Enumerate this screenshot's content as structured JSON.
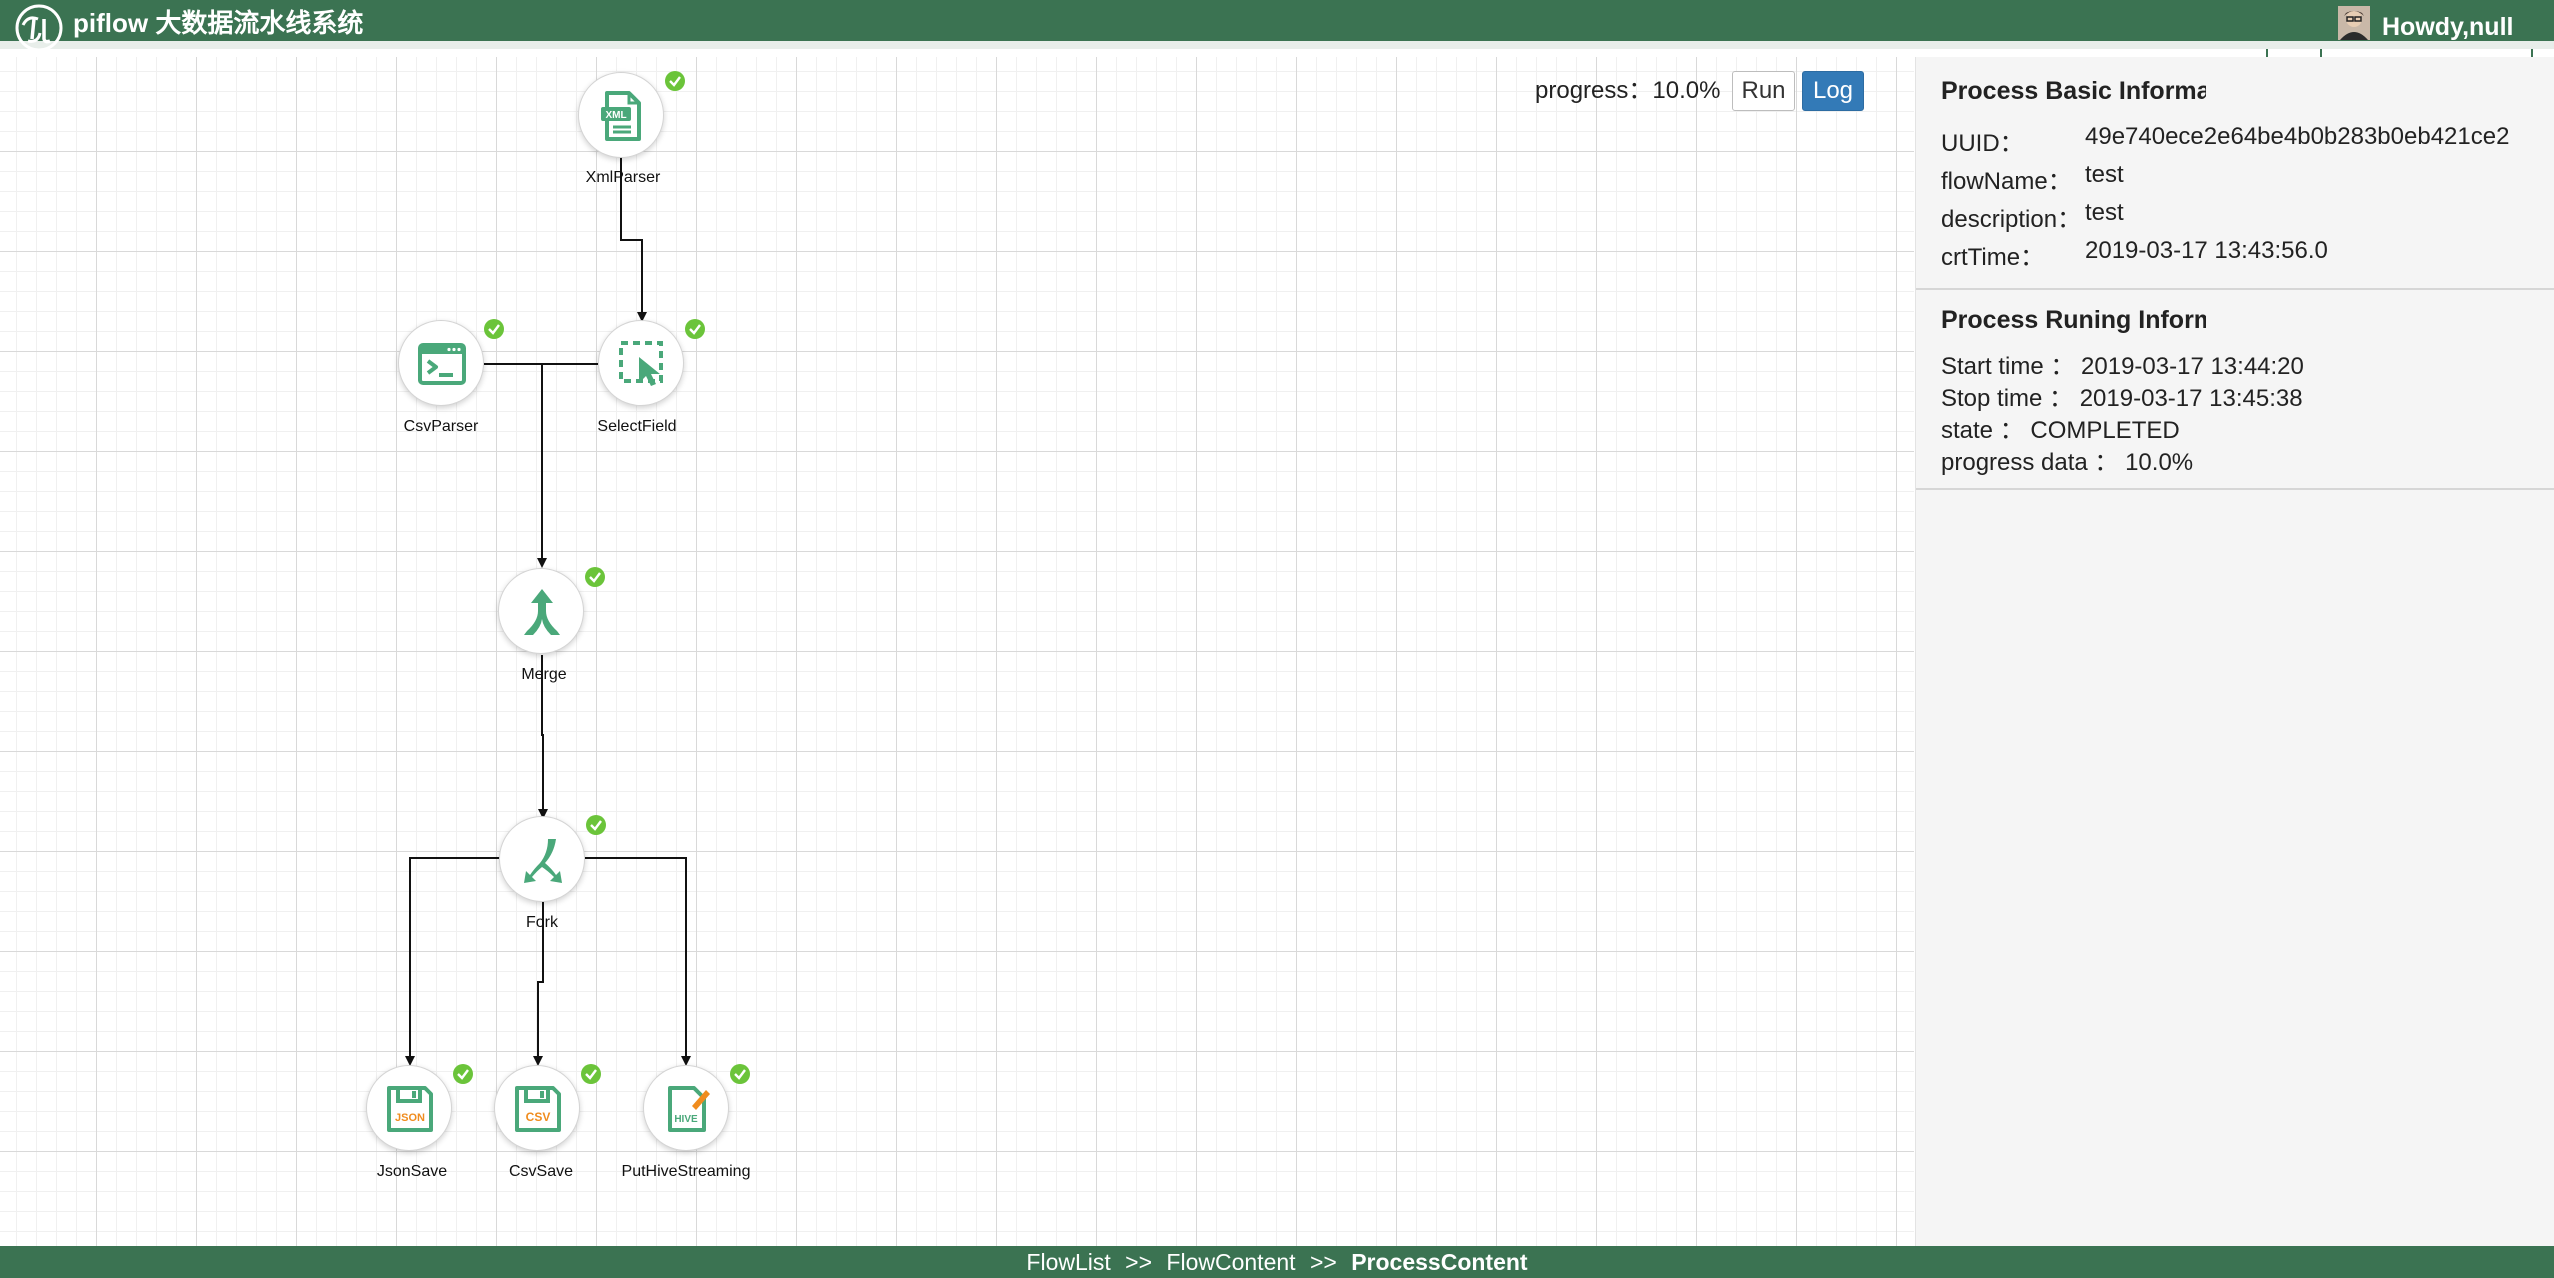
{
  "header": {
    "app_title": "piflow 大数据流水线系统",
    "greeting": "Howdy,null",
    "logo_icon": "piflow-logo-icon",
    "brand_color": "#3b7352"
  },
  "toolbar": {
    "progress_label": "progress：10.0%",
    "run_label": "Run",
    "log_label": "Log"
  },
  "flow": {
    "nodes": [
      {
        "name": "XmlParser",
        "icon": "xml-file-icon",
        "status": "completed"
      },
      {
        "name": "CsvParser",
        "icon": "terminal-window-icon",
        "status": "completed"
      },
      {
        "name": "SelectField",
        "icon": "select-cursor-icon",
        "status": "completed"
      },
      {
        "name": "Merge",
        "icon": "merge-arrow-icon",
        "status": "completed"
      },
      {
        "name": "Fork",
        "icon": "fork-arrow-icon",
        "status": "completed"
      },
      {
        "name": "JsonSave",
        "icon": "json-save-icon",
        "status": "completed"
      },
      {
        "name": "CsvSave",
        "icon": "csv-save-icon",
        "status": "completed"
      },
      {
        "name": "PutHiveStreaming",
        "icon": "hive-file-icon",
        "status": "completed"
      }
    ],
    "icon_texts": {
      "xml": "XML",
      "json": "JSON",
      "csv": "CSV",
      "hive": "HIVE"
    }
  },
  "panel": {
    "basic_title": "Process Basic Informat",
    "basic": [
      {
        "key": "UUID：",
        "value": "49e740ece2e64be4b0b283b0eb421ce2"
      },
      {
        "key": "flowName：",
        "value": "test"
      },
      {
        "key": "description：",
        "value": "test"
      },
      {
        "key": "crtTime：",
        "value": "2019-03-17 13:43:56.0"
      }
    ],
    "running_title": "Process Runing Informa",
    "running": [
      "Start time  ：  2019-03-17 13:44:20",
      "Stop time  ：  2019-03-17 13:45:38",
      "state  ：  COMPLETED",
      "progress data  ：  10.0%"
    ]
  },
  "footer": {
    "crumbs": [
      "FlowList",
      "FlowContent"
    ],
    "separator": ">>",
    "current": "ProcessContent"
  }
}
